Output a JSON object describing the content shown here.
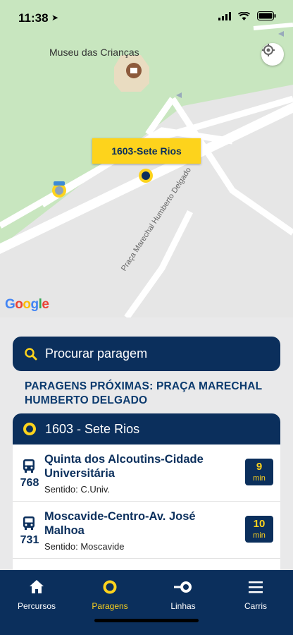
{
  "status_bar": {
    "time": "11:38"
  },
  "map": {
    "poi_label": "Museu das Crianças",
    "selected_stop_label": "1603-Sete Rios",
    "street_label": "Praça Marechal Humberto Delgado",
    "attribution": [
      "G",
      "o",
      "o",
      "g",
      "l",
      "e"
    ]
  },
  "search": {
    "placeholder": "Procurar paragem"
  },
  "nearby": {
    "title": "PARAGENS PRÓXIMAS: PRAÇA MARECHAL HUMBERTO DELGADO"
  },
  "stop": {
    "title": "1603 - Sete Rios",
    "routes": [
      {
        "number": "768",
        "destination": "Quinta dos Alcoutins-Cidade Universitária",
        "direction": "Sentido: C.Univ.",
        "eta_value": "9",
        "eta_unit": "min"
      },
      {
        "number": "731",
        "destination": "Moscavide-Centro-Av. José Malhoa",
        "direction": "Sentido: Moscavide",
        "eta_value": "10",
        "eta_unit": "min"
      }
    ]
  },
  "tabs": [
    {
      "label": "Percursos",
      "icon": "home-icon",
      "active": false
    },
    {
      "label": "Paragens",
      "icon": "stop-ring-icon",
      "active": true
    },
    {
      "label": "Linhas",
      "icon": "line-icon",
      "active": false
    },
    {
      "label": "Carris",
      "icon": "menu-icon",
      "active": false
    }
  ],
  "colors": {
    "navy": "#0b2f5c",
    "yellow": "#fdd31c",
    "park": "#c8e6bf"
  }
}
